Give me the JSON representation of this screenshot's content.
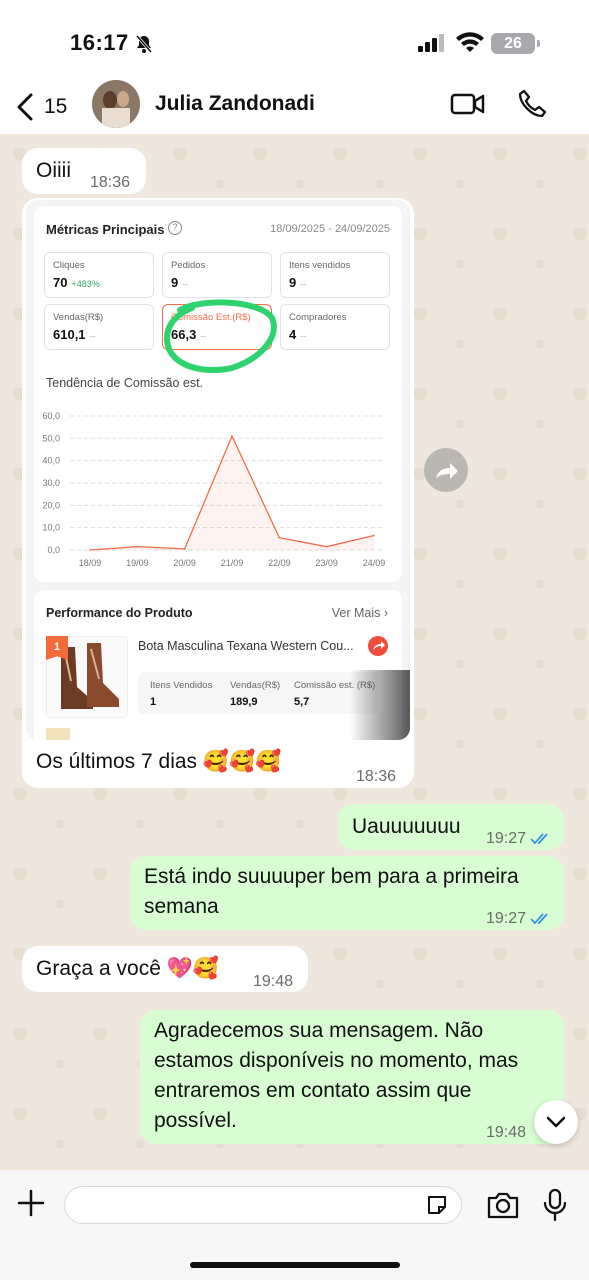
{
  "status": {
    "time": "16:17",
    "battery": "26"
  },
  "header": {
    "back_count": "15",
    "contact_name": "Julia Zandonadi"
  },
  "messages": {
    "m1": {
      "text": "Oiiii",
      "time": "18:36"
    },
    "m2": {
      "caption": "Os últimos 7 dias 🥰🥰🥰",
      "time": "18:36"
    },
    "m3": {
      "text": "Uauuuuuuu",
      "time": "19:27"
    },
    "m4": {
      "text": "Está indo suuuuper bem para a primeira semana",
      "time": "19:27"
    },
    "m5": {
      "text": "Graça a você 💖🥰",
      "time": "19:48"
    },
    "m6": {
      "text": "Agradecemos sua mensagem. Não estamos disponíveis no momento, mas entraremos em contato assim que possível.",
      "time": "19:48"
    }
  },
  "metrics": {
    "title": "Métricas Principais",
    "range": "18/09/2025 - 24/09/2025",
    "tiles": [
      {
        "label": "Cliques",
        "value": "70",
        "delta": "+483%"
      },
      {
        "label": "Pedidos",
        "value": "9",
        "delta": "--"
      },
      {
        "label": "Itens vendidos",
        "value": "9",
        "delta": "--"
      },
      {
        "label": "Vendas(R$)",
        "value": "610,1",
        "delta": "--"
      },
      {
        "label": "Comissão Est.(R$)",
        "value": "66,3",
        "delta": "--"
      },
      {
        "label": "Compradores",
        "value": "4",
        "delta": "--"
      }
    ],
    "trend_title": "Tendência de Comissão est."
  },
  "chart_data": {
    "type": "area",
    "title": "Tendência de Comissão est.",
    "categories": [
      "18/09",
      "19/09",
      "20/09",
      "21/09",
      "22/09",
      "23/09",
      "24/09"
    ],
    "values": [
      0.0,
      1.5,
      0.5,
      51.0,
      5.5,
      1.5,
      6.5
    ],
    "ylim": [
      0,
      60
    ],
    "yticks": [
      "0,0",
      "10,0",
      "20,0",
      "30,0",
      "40,0",
      "50,0",
      "60,0"
    ],
    "color": "#f26b4a",
    "grid": true
  },
  "performance": {
    "title": "Performance do Produto",
    "see_more": "Ver Mais",
    "rank": "1",
    "product_name": "Bota Masculina Texana Western Cou...",
    "stats_labels": [
      "Itens Vendidos",
      "Vendas(R$)",
      "Comissão est. (R$)"
    ],
    "stats_values": [
      "1",
      "189,9",
      "5,7"
    ]
  }
}
